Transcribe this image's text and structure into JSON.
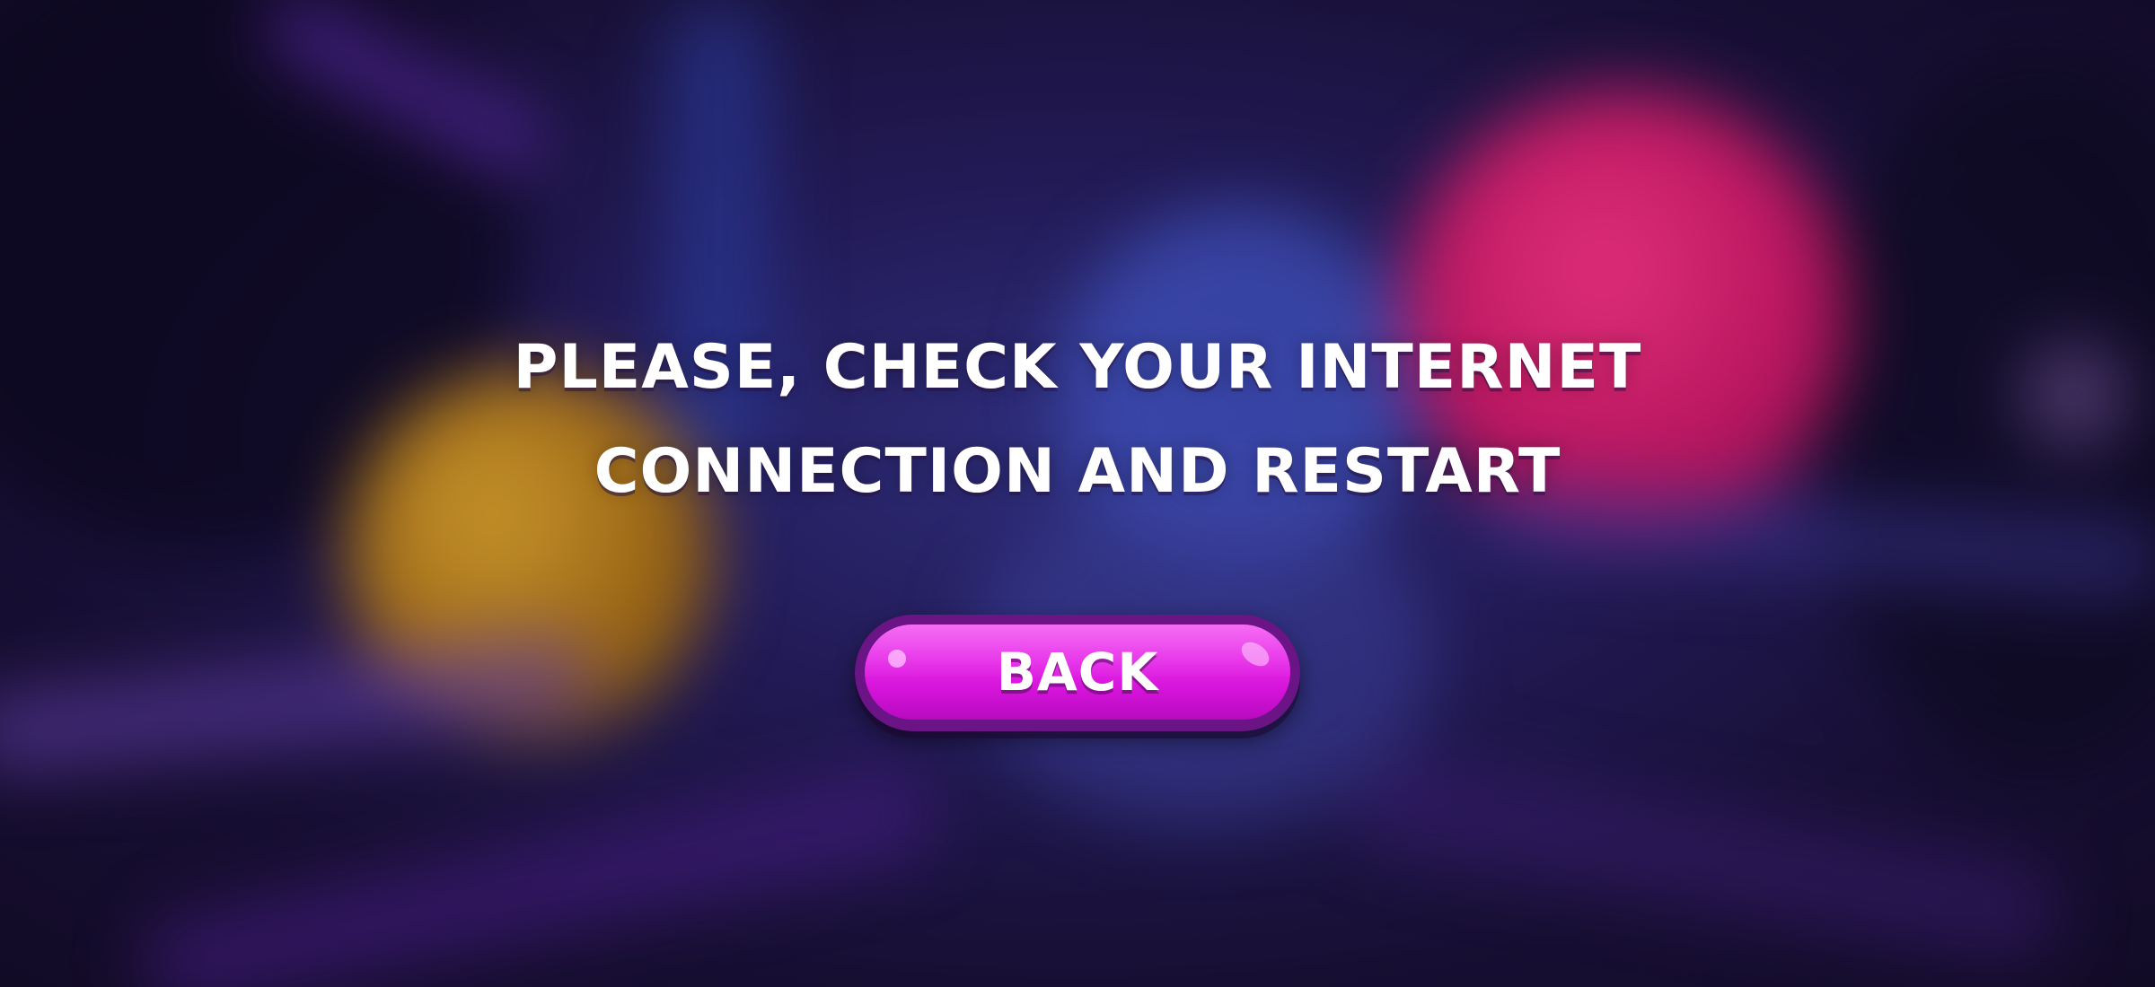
{
  "dialog": {
    "message_line1": "PLEASE, CHECK YOUR INTERNET",
    "message_line2": "CONNECTION AND RESTART"
  },
  "back_button": {
    "label": "BACK"
  },
  "background": {
    "elements": [
      "gold-ball",
      "pink-ball",
      "blue-ball"
    ],
    "colors": {
      "base": "#1a1230",
      "gold_ball": "#b07a1a",
      "pink_ball": "#c41a6a",
      "button_fill": "#e324e6",
      "button_border": "#6a1486"
    }
  }
}
